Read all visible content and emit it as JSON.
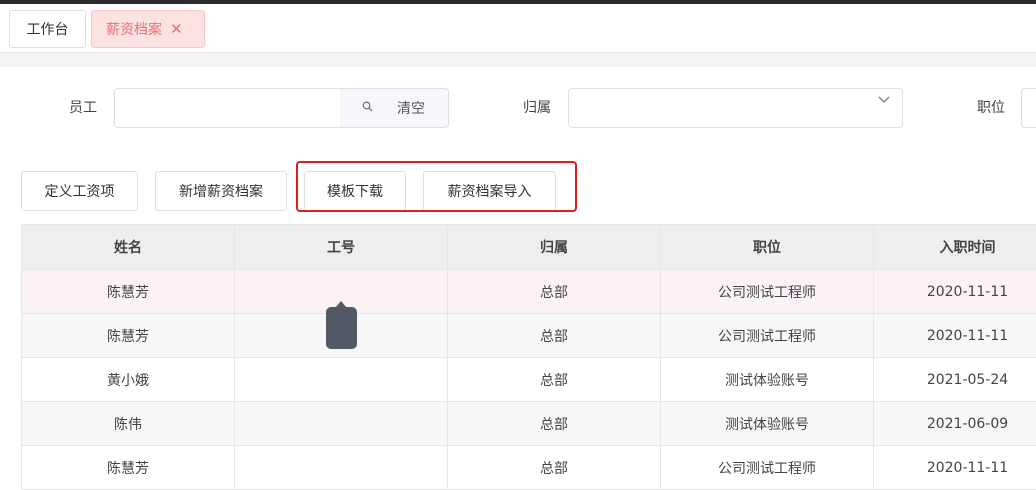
{
  "tabs": [
    {
      "label": "工作台"
    },
    {
      "label": "薪资档案",
      "close": "✕"
    }
  ],
  "filters": {
    "employee_label": "员工",
    "employee_value": "",
    "search_icon": "search-icon",
    "search_clear": "清空",
    "belong_label": "归属",
    "belong_value": "",
    "position_label": "职位"
  },
  "toolbar": {
    "define_salary": "定义工资项",
    "add_archive": "新增薪资档案",
    "template_download": "模板下载",
    "archive_import": "薪资档案导入"
  },
  "table": {
    "headers": [
      "姓名",
      "工号",
      "归属",
      "职位",
      "入职时间"
    ],
    "rows": [
      [
        "陈慧芳",
        "",
        "总部",
        "公司测试工程师",
        "2020-11-11"
      ],
      [
        "陈慧芳",
        "",
        "总部",
        "公司测试工程师",
        "2020-11-11"
      ],
      [
        "黄小娥",
        "",
        "总部",
        "测试体验账号",
        "2021-05-24"
      ],
      [
        "陈伟",
        "",
        "总部",
        "测试体验账号",
        "2021-06-09"
      ],
      [
        "陈慧芳",
        "",
        "总部",
        "公司测试工程师",
        "2020-11-11"
      ]
    ]
  },
  "colors": {
    "active_tab_bg": "#fde2e2",
    "active_tab_text": "#e57373",
    "highlight_border": "#e21d1d",
    "tooltip_bg": "#525866"
  }
}
